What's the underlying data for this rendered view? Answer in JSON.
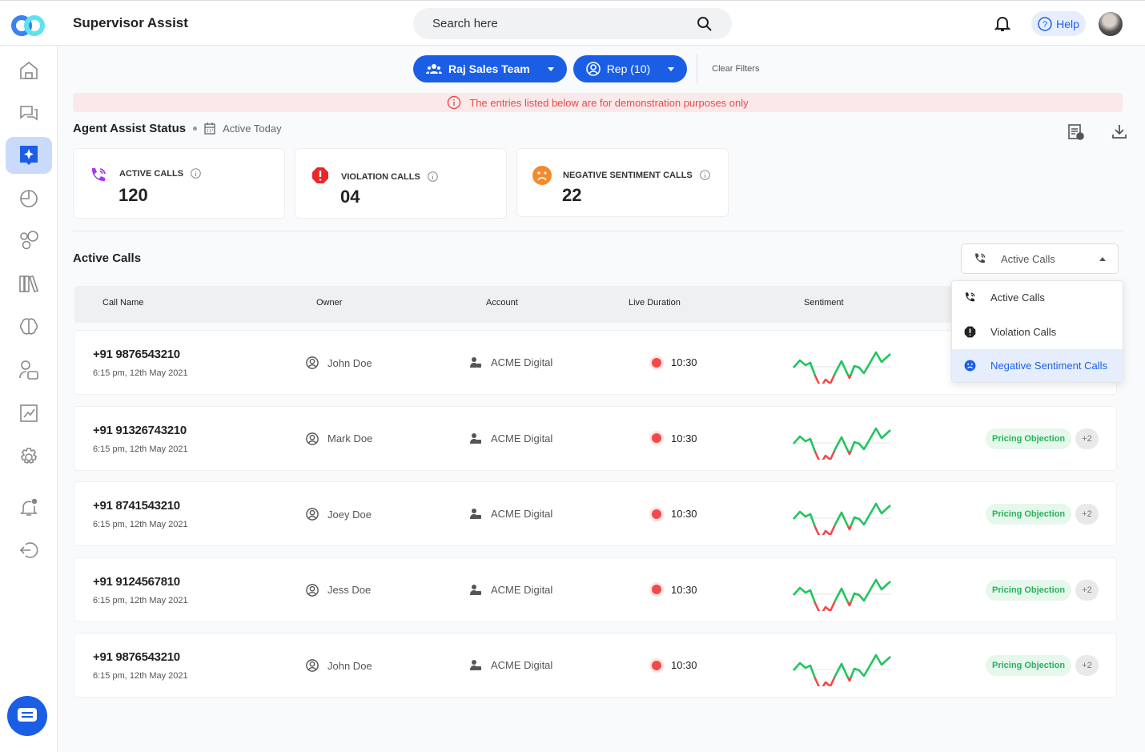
{
  "header": {
    "title": "Supervisor Assist",
    "search_placeholder": "Search here",
    "help_label": "Help"
  },
  "sidebar": {
    "items": [
      {
        "icon": "home-icon"
      },
      {
        "icon": "chat-icon"
      },
      {
        "icon": "agent-assist-icon",
        "active": true
      },
      {
        "icon": "pie-chart-icon"
      },
      {
        "icon": "bubbles-icon"
      },
      {
        "icon": "library-icon"
      },
      {
        "icon": "brain-icon"
      },
      {
        "icon": "user-briefcase-icon"
      },
      {
        "icon": "line-chart-icon"
      },
      {
        "icon": "gear-icon"
      },
      {
        "icon": "bell-alert-icon"
      },
      {
        "icon": "logout-icon"
      }
    ]
  },
  "filters": {
    "team": "Raj Sales Team",
    "rep": "Rep (10)",
    "clear": "Clear Filters"
  },
  "banner": "The entries listed below are for demonstration purposes only",
  "status": {
    "title": "Agent Assist Status",
    "period": "Active Today"
  },
  "cards": [
    {
      "label": "ACTIVE CALLS",
      "value": "120",
      "color": "#a23bf0"
    },
    {
      "label": "VIOLATION CALLS",
      "value": "04",
      "color": "#e8262b"
    },
    {
      "label": "NEGATIVE SENTIMENT CALLS",
      "value": "22",
      "color": "#f7892d"
    }
  ],
  "active_calls": {
    "title": "Active Calls",
    "select_value": "Active Calls",
    "menu": [
      "Active Calls",
      "Violation Calls",
      "Negative Sentiment Calls"
    ],
    "columns": [
      "Call Name",
      "Owner",
      "Account",
      "Live Duration",
      "Sentiment"
    ],
    "rows": [
      {
        "number": "+91 9876543210",
        "time": "6:15 pm, 12th May 2021",
        "owner": "John Doe",
        "account": "ACME Digital",
        "duration": "10:30",
        "tag": "",
        "more": ""
      },
      {
        "number": "+91 91326743210",
        "time": "6:15 pm, 12th May 2021",
        "owner": "Mark Doe",
        "account": "ACME Digital",
        "duration": "10:30",
        "tag": "Pricing Objection",
        "more": "+2"
      },
      {
        "number": "+91 8741543210",
        "time": "6:15 pm, 12th May 2021",
        "owner": "Joey Doe",
        "account": "ACME Digital",
        "duration": "10:30",
        "tag": "Pricing Objection",
        "more": "+2"
      },
      {
        "number": "+91 9124567810",
        "time": "6:15 pm, 12th May 2021",
        "owner": "Jess Doe",
        "account": "ACME Digital",
        "duration": "10:30",
        "tag": "Pricing Objection",
        "more": "+2"
      },
      {
        "number": "+91 9876543210",
        "time": "6:15 pm, 12th May 2021",
        "owner": "John Doe",
        "account": "ACME Digital",
        "duration": "10:30",
        "tag": "Pricing Objection",
        "more": "+2"
      }
    ]
  },
  "colors": {
    "primary": "#1b5ee6",
    "positive": "#22c55e",
    "negative": "#f04b4b"
  }
}
